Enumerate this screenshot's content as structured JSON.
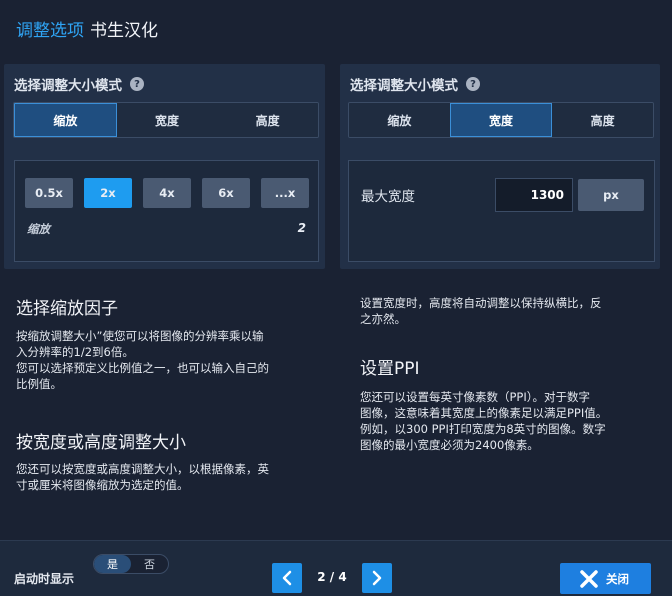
{
  "header": {
    "title_accent": "调整选项",
    "title_rest": "书生汉化"
  },
  "scale_panel": {
    "title": "选择调整大小模式",
    "help_icon": "?",
    "modes": [
      "缩放",
      "宽度",
      "高度"
    ],
    "active_mode": "缩放",
    "scale_options": [
      "0.5x",
      "2x",
      "4x",
      "6x",
      "...x"
    ],
    "active_option": "2x",
    "scale_label": "缩放",
    "scale_value": "2"
  },
  "width_panel": {
    "title": "选择调整大小模式",
    "help_icon": "?",
    "modes": [
      "缩放",
      "宽度",
      "高度"
    ],
    "active_mode": "宽度",
    "max_width_label": "最大宽度",
    "max_width_value": "1300",
    "unit": "px"
  },
  "help": {
    "scale_heading": "选择缩放因子",
    "scale_text_1": "按缩放调整大小”使您可以将图像的分辨率乘以输",
    "scale_text_2": "入分辨率的1/2到6倍。",
    "scale_text_3": "您可以选择预定义比例值之一，也可以输入自己的",
    "scale_text_4": "比例值。",
    "dimension_heading": "按宽度或高度调整大小",
    "dimension_text_1": "您还可以按宽度或高度调整大小，以根据像素，英",
    "dimension_text_2": "寸或厘米将图像缩放为选定的值。",
    "width_text_1": "设置宽度时，高度将自动调整以保持纵横比，反",
    "width_text_2": "之亦然。",
    "ppi_heading": "设置PPI",
    "ppi_text_1": "您还可以设置每英寸像素数（PPI）。对于数字",
    "ppi_text_2": "图像，这意味着其宽度上的像素足以满足PPI值。",
    "ppi_text_3": "例如，以300 PPI打印宽度为8英寸的图像。数字",
    "ppi_text_4": "图像的最小宽度必须为2400像素。"
  },
  "footer": {
    "startup_label": "启动时显示",
    "toggle_yes": "是",
    "toggle_no": "否",
    "page_indicator": "2 / 4",
    "close_label": "关闭"
  },
  "icons": {
    "prev": "chevron-left-icon",
    "next": "chevron-right-icon",
    "close": "close-x-icon"
  },
  "colors": {
    "accent": "#2fa4f4",
    "active_option": "#1e9cf0",
    "button_blue": "#1e7fe0"
  }
}
